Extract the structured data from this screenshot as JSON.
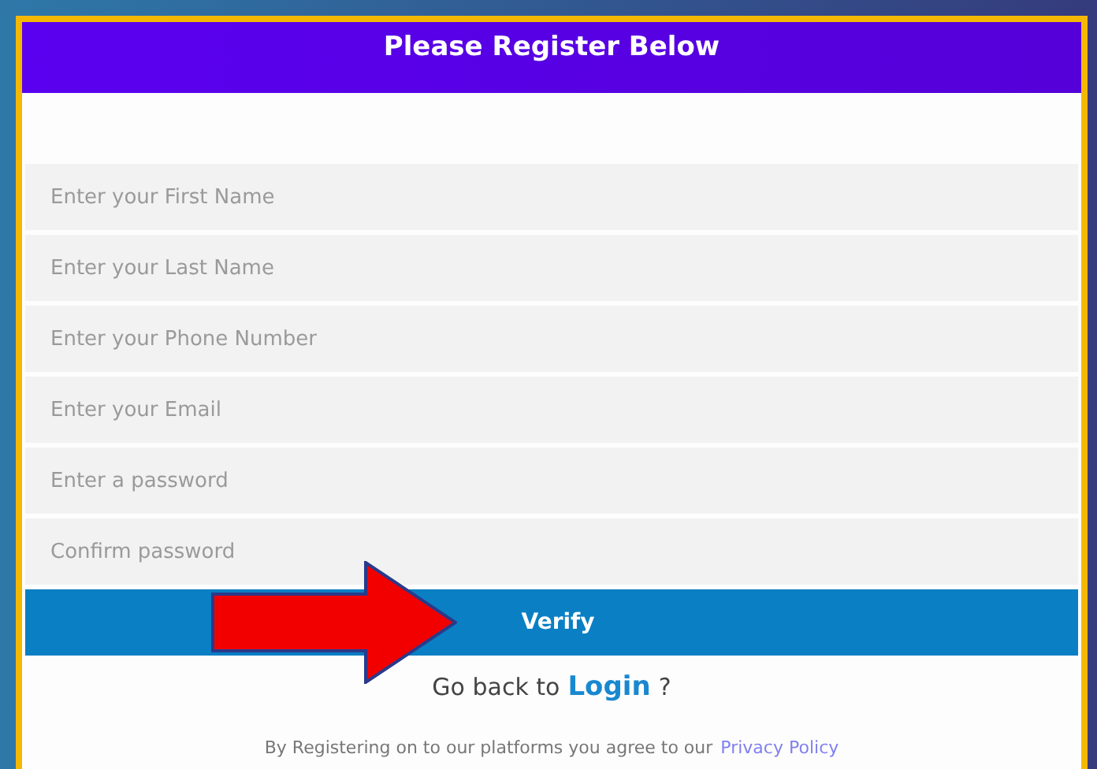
{
  "header": {
    "title": "Please Register Below"
  },
  "fields": [
    {
      "placeholder": "Enter your First Name"
    },
    {
      "placeholder": "Enter your Last Name"
    },
    {
      "placeholder": "Enter your Phone Number"
    },
    {
      "placeholder": "Enter your Email"
    },
    {
      "placeholder": "Enter a password"
    },
    {
      "placeholder": "Confirm password"
    }
  ],
  "verify_button": "Verify",
  "login_prompt": {
    "text": "Go back to",
    "link": "Login",
    "suffix": "?"
  },
  "policy": {
    "text": "By Registering on to our platforms you agree to our",
    "link": "Privacy Policy"
  }
}
